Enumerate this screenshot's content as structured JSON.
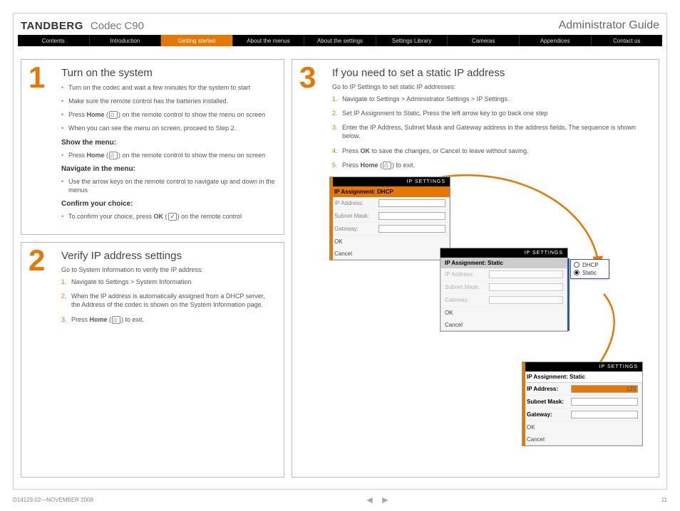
{
  "header": {
    "brand": "TANDBERG",
    "model": "Codec C90",
    "guide": "Administrator Guide"
  },
  "nav": {
    "items": [
      "Contents",
      "Introduction",
      "Getting started",
      "About the menus",
      "About the settings",
      "Settings Library",
      "Cameras",
      "Appendices",
      "Contact us"
    ],
    "active_index": 2
  },
  "panel1": {
    "num": "1",
    "title": "Turn on the system",
    "bullets_a": [
      "Turn on the codec and wait a few minutes for the system to start",
      "Make sure the remote control has the batteries installed.",
      "Press <b>Home</b> (⌂) on the remote control to show the menu on screen",
      "When you can see the menu on screen, proceed to Step 2."
    ],
    "sub1": "Show the menu:",
    "bullets_b": [
      "Press <b>Home</b> (⌂) on the remote control to show the menu on screen"
    ],
    "sub2": "Navigate in the menu:",
    "bullets_c": [
      "Use the arrow keys on the remote control to navigate up and down in the menus"
    ],
    "sub3": "Confirm your choice:",
    "bullets_d": [
      "To confirm your choice, press <b>OK</b> (✓) on the remote control"
    ]
  },
  "panel2": {
    "num": "2",
    "title": "Verify IP address settings",
    "intro": "Go to System Information to verify the IP address:",
    "steps": [
      "Navigate to Settings > System Information",
      "When the IP address is automatically assigned from a DHCP server, the Address of the codec is shown on the System Information page.",
      "Press <b>Home</b> (⌂) to exit."
    ]
  },
  "panel3": {
    "num": "3",
    "title": "If you need to set a static IP address",
    "intro": "Go to IP Settings to set static IP addresses:",
    "steps": [
      "Navigate to Settings > Administrator Settings > IP Settings.",
      "Set IP Assignment to Static. Press the left arrow key to go back one step",
      "Enter the IP Address, Subnet Mask and Gateway address in the address fields. The sequence is shown below.",
      "Press <b>OK</b> to save the changes, or Cancel to leave without saving.",
      "Press <b>Home</b> (⌂) to exit."
    ]
  },
  "shots": {
    "titlebar": "IP SETTINGS",
    "labels": {
      "ip": "IP Address:",
      "mask": "Subnet Mask:",
      "gw": "Gateway:",
      "ok": "OK",
      "cancel": "Cancel"
    },
    "s1": {
      "row": "IP Assignment: DHCP"
    },
    "s2": {
      "row": "IP Assignment: Static"
    },
    "s3": {
      "row": "IP Assignment: Static",
      "ip_value": "123"
    },
    "popup": {
      "opt1": "DHCP",
      "opt2": "Static"
    }
  },
  "footer": {
    "doc": "D14129.02—NOVEMBER 2008",
    "page": "11"
  }
}
